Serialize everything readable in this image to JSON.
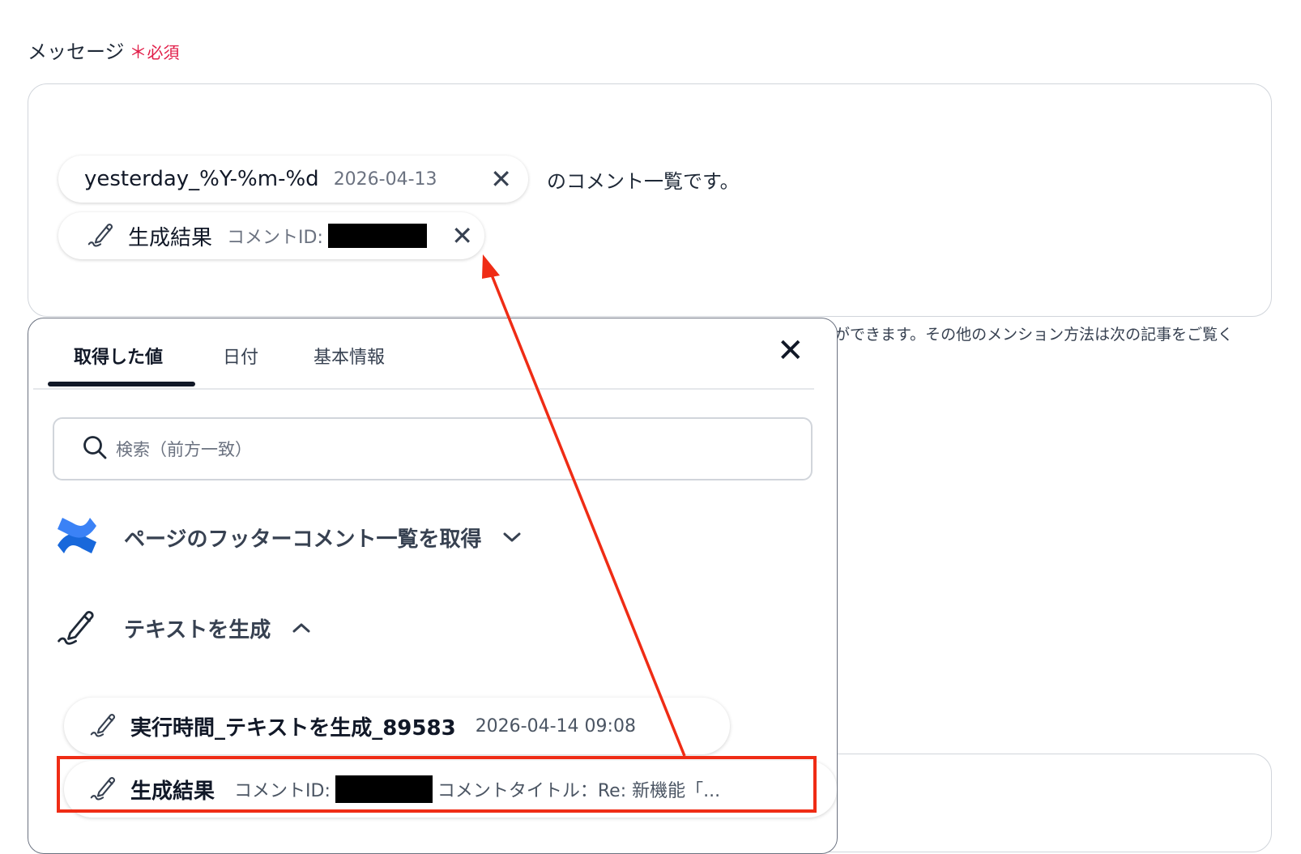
{
  "field": {
    "label": "メッセージ",
    "required_star": "＊",
    "required_text": "必須"
  },
  "message": {
    "date_pill": {
      "name": "yesterday_%Y-%m-%d",
      "value": "2026-04-13",
      "close": "✕"
    },
    "after_text": "のコメント一覧です。",
    "comment_pill": {
      "name": "生成結果",
      "value_label": "コメントID:",
      "close": "✕"
    }
  },
  "help_text": "ができます。その他のメンション方法は次の記事をご覧く",
  "panel": {
    "tabs": [
      {
        "label": "取得した値",
        "active": true
      },
      {
        "label": "日付",
        "active": false
      },
      {
        "label": "基本情報",
        "active": false
      }
    ],
    "close": "✕",
    "search": {
      "placeholder": "検索（前方一致）"
    },
    "groups": [
      {
        "icon": "confluence-logo-icon",
        "title": "ページのフッターコメント一覧を取得",
        "state": "collapsed"
      },
      {
        "icon": "pen-signature-icon",
        "title": "テキストを生成",
        "state": "expanded"
      }
    ],
    "items": [
      {
        "icon": "pen-signature-icon",
        "name": "実行時間_テキストを生成_89583",
        "value": "2026-04-14 09:08"
      },
      {
        "icon": "pen-signature-icon",
        "name": "生成結果",
        "value_label": "コメントID:",
        "value_suffix": "コメントタイトル：Re: 新機能「..."
      }
    ]
  },
  "colors": {
    "required": "#e11d48",
    "annotation_red": "#ef2c15",
    "confluence_blue": "#1868db"
  }
}
